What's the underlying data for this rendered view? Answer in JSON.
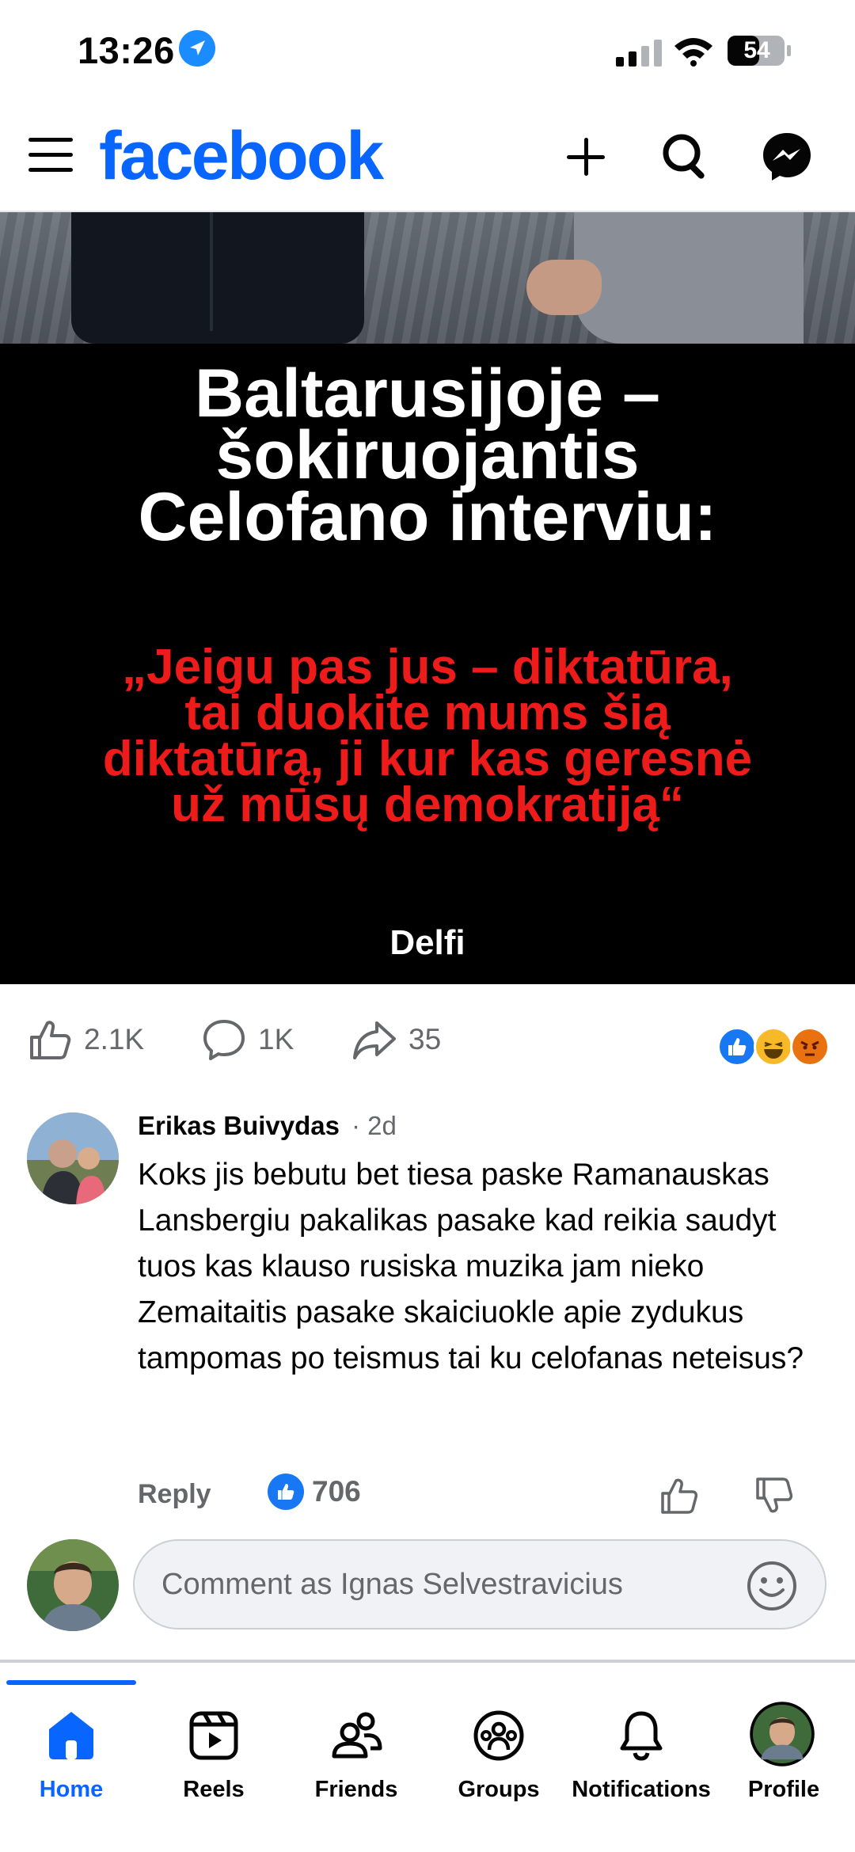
{
  "status_bar": {
    "time": "13:26",
    "battery": "54"
  },
  "header": {
    "logo": "facebook",
    "icons": [
      "menu-icon",
      "plus-icon",
      "search-icon",
      "messenger-icon"
    ]
  },
  "post_image": {
    "headline_lines": [
      "Baltarusijoje –",
      "šokiruojantis",
      "Celofano interviu:"
    ],
    "quote_lines": [
      "„Jeigu pas jus – diktatūra,",
      "tai duokite mums šią",
      "diktatūrą, ji kur kas geresnė",
      "už mūsų demokratiją“"
    ],
    "source": "Delfi"
  },
  "post_actions": {
    "likes": "2.1K",
    "comments": "1K",
    "shares": "35",
    "reactions": [
      "like",
      "haha",
      "angry"
    ]
  },
  "comment": {
    "author": "Erikas Buivydas",
    "time": "· 2d",
    "text": "Koks jis bebutu bet tiesa paske Ramanauskas Lansbergiu pakalikas pasake kad reikia saudyt tuos kas klauso rusiska muzika jam nieko Zemaitaitis pasake skaiciuokle apie zydukus tampomas po teismus tai ku celofanas neteisus?",
    "reply_label": "Reply",
    "likes": "706"
  },
  "composer": {
    "placeholder": "Comment as Ignas Selvestravicius"
  },
  "bottom_nav": {
    "home": "Home",
    "reels": "Reels",
    "friends": "Friends",
    "groups": "Groups",
    "notifications": "Notifications",
    "profile": "Profile"
  },
  "colors": {
    "brand": "#0866ff",
    "quote_red": "#ee1b1b",
    "muted": "#65676b"
  }
}
